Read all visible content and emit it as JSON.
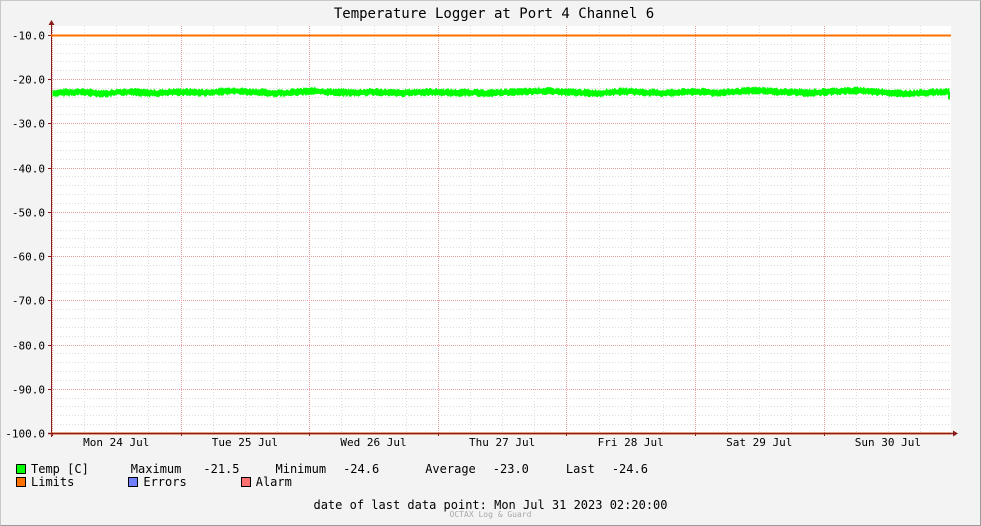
{
  "chart_data": {
    "type": "line",
    "title": "Temperature Logger at Port 4 Channel 6",
    "xlabel": "",
    "ylabel": "",
    "ylim": [
      -100,
      -8
    ],
    "y_ticks": [
      "-10.0",
      "-20.0",
      "-30.0",
      "-40.0",
      "-50.0",
      "-60.0",
      "-70.0",
      "-80.0",
      "-90.0",
      "-100.0"
    ],
    "y_tick_values": [
      -10,
      -20,
      -30,
      -40,
      -50,
      -60,
      -70,
      -80,
      -90,
      -100
    ],
    "x_ticks": [
      "Mon 24 Jul",
      "Tue 25 Jul",
      "Wed 26 Jul",
      "Thu 27 Jul",
      "Fri 28 Jul",
      "Sat 29 Jul",
      "Sun 30 Jul"
    ],
    "x_range_days": 7,
    "grid": true,
    "series": [
      {
        "name": "Temp [C]",
        "color": "#00ff00",
        "values": [
          -23.2,
          -23.0,
          -22.9,
          -23.1,
          -23.3,
          -23.0,
          -22.8,
          -23.1,
          -23.2,
          -23.0,
          -22.9,
          -23.0,
          -23.1,
          -22.8,
          -22.6,
          -22.9,
          -23.0,
          -23.2,
          -23.1,
          -22.9,
          -22.7,
          -22.9,
          -23.0,
          -23.1,
          -23.0,
          -22.9,
          -23.1,
          -23.2,
          -23.0,
          -22.9,
          -23.0,
          -23.1,
          -23.0,
          -23.2,
          -23.1,
          -23.0,
          -22.9,
          -22.8,
          -22.7,
          -22.9,
          -23.0,
          -23.1,
          -23.2,
          -23.0,
          -22.8,
          -22.9,
          -23.1,
          -23.2,
          -23.0,
          -22.9,
          -22.9,
          -23.1,
          -23.0,
          -22.8,
          -22.6,
          -22.7,
          -22.9,
          -23.0,
          -23.1,
          -23.0,
          -22.8,
          -22.7,
          -22.6,
          -22.8,
          -23.0,
          -23.2,
          -23.3,
          -23.1,
          -23.0,
          -22.9
        ],
        "band": [
          -22.2,
          -23.8
        ]
      },
      {
        "name": "Limits",
        "color": "#ff7000",
        "values": [
          -10.0,
          -100.0
        ]
      },
      {
        "name": "Errors",
        "color": "#7080ff",
        "values": []
      },
      {
        "name": "Alarm",
        "color": "#ff7070",
        "values": []
      }
    ]
  },
  "stats": {
    "series_label": "Temp [C]",
    "maximum_label": "Maximum",
    "maximum_value": "-21.5",
    "minimum_label": "Minimum",
    "minimum_value": "-24.6",
    "average_label": "Average",
    "average_value": "-23.0",
    "last_label": "Last",
    "last_value": "-24.6"
  },
  "legend": {
    "limits_label": "Limits",
    "errors_label": "Errors",
    "alarm_label": "Alarm"
  },
  "footer": {
    "last_point_text": "date of last data point:  Mon Jul 31 2023 02:20:00",
    "watermark": "OCTAX Log & Guard"
  },
  "colors": {
    "background": "#f3f3f3",
    "plot_background": "#ffffff",
    "axis": "#8b1a1a",
    "minor_grid": "#dcdcdc",
    "major_grid": "#e6a0a0"
  }
}
